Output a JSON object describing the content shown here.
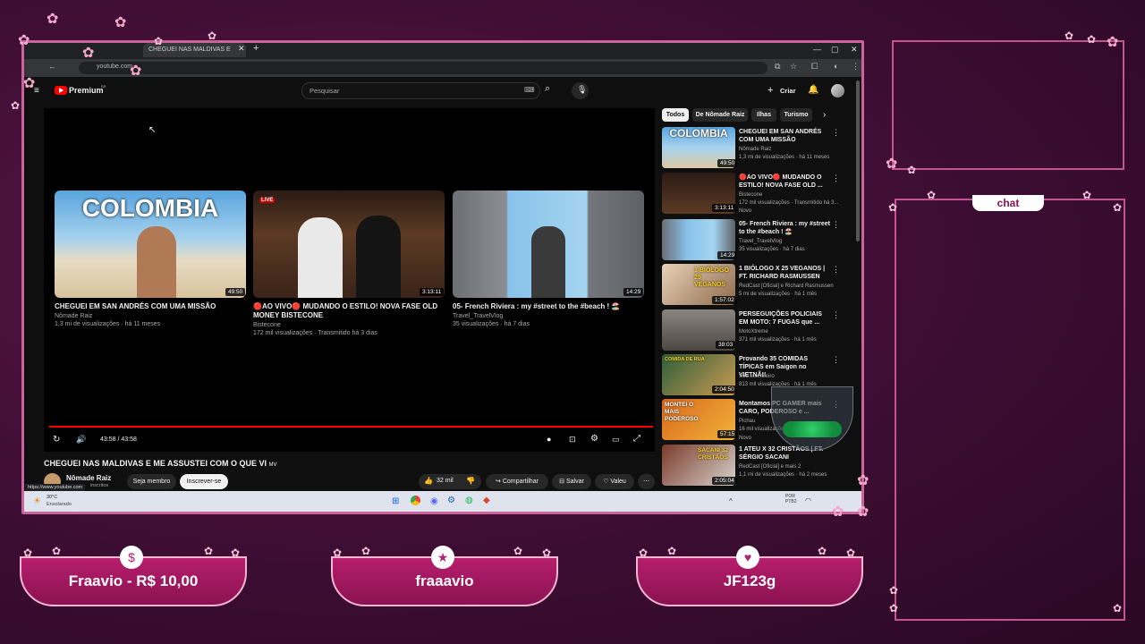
{
  "browser": {
    "tab_label": "CHEGUEI NAS MALDIVAS E ME...",
    "url": "youtube.com",
    "status_url": "https://www.youtube.com"
  },
  "youtube": {
    "logo_text": "Premium",
    "logo_badge": "BR",
    "search_placeholder": "Pesquisar",
    "create_label": "Criar",
    "video_time": "43:58 / 43:58",
    "end_cards": [
      {
        "title": "CHEGUEI EM SAN ANDRÉS COM UMA MISSÃO",
        "channel": "Nômade Raiz",
        "meta": "1,3 mi de visualizações · há 11 meses",
        "duration": "49:50",
        "thumb_text": "COLOMBIA"
      },
      {
        "title": "🔴AO VIVO🔴 MUDANDO O ESTILO! NOVA FASE OLD MONEY BISTECONE",
        "channel": "Bistecone",
        "meta": "172 mil visualizações · Transmitido há 3 dias",
        "duration": "3:13:11",
        "badge": "LIVE"
      },
      {
        "title": "05- French Riviera : my #street to the #beach ! 🏖️",
        "channel": "Travel_TravelVlog",
        "meta": "35 visualizações · há 7 dias",
        "duration": "14:29"
      }
    ],
    "video_title": "CHEGUEI NAS MALDIVAS E ME ASSUSTEI COM O QUE VI",
    "video_title_suffix": "MV",
    "channel_name": "Nômade Raiz",
    "subscribers": "inscritos",
    "member_button": "Seja membro",
    "subscribe_button": "Inscrever-se",
    "likes": "32 mil",
    "share": "Compartilhar",
    "save": "Salvar",
    "thanks": "Valeu",
    "chips": [
      "Todos",
      "De Nômade Raiz",
      "Ilhas",
      "Turismo"
    ],
    "related": [
      {
        "title": "CHEGUEI EM SAN ANDRÉS COM UMA MISSÃO",
        "channel": "Nômade Raiz",
        "meta": "1,3 mi de visualizações · há 11 meses",
        "duration": "49:50",
        "thumb_text": "COLOMBIA"
      },
      {
        "title": "🔴AO VIVO🔴 MUDANDO O ESTILO! NOVA FASE OLD ...",
        "channel": "Bistecone",
        "meta": "172 mil visualizações · Transmitido há 3...",
        "extra": "Novo",
        "duration": "3:13:11"
      },
      {
        "title": "05- French Riviera : my #street to the #beach ! 🏖️",
        "channel": "Travel_TravelVlog",
        "meta": "35 visualizações · há 7 dias",
        "duration": "14:29"
      },
      {
        "title": "1 BIÓLOGO X 25 VEGANOS | FT. RICHARD RASMUSSEN",
        "channel": "RedCast [Oficial] e Richard Rasmussen",
        "meta": "5 mi de visualizações · há 1 mês",
        "duration": "1:57:02",
        "thumb_text": "1 BIÓLOGO 25 VEGANOS"
      },
      {
        "title": "PERSEGUIÇÕES POLICIAIS EM MOTO: 7 FUGAS que ...",
        "channel": "MotoXtreme",
        "meta": "371 mil visualizações · há 1 mês",
        "duration": "38:03"
      },
      {
        "title": "Provando 35 COMIDAS TÍPICAS em Saigon no VIETNÃ!!",
        "channel": "Sou Mochileiro",
        "meta": "813 mil visualizações · há 1 mês",
        "duration": "2:04:50",
        "thumb_text": "COMIDA DE RUA"
      },
      {
        "title": "Montamos PC GAMER mais CARO, PODEROSO e ...",
        "channel": "Pichau",
        "meta": "16 mil visualizações",
        "extra": "Novo",
        "duration": "57:15",
        "thumb_text": "MONTEI O MAIS PODEROSO"
      },
      {
        "title": "1 ATEU X 32 CRISTÃOS | FT. SÉRGIO SACANI",
        "channel": "RedCast [Oficial] e mais 2",
        "meta": "1,1 mi de visualizações · há 2 meses",
        "duration": "2:05:04",
        "thumb_text": "SACANI 32 CRISTÃOS"
      }
    ]
  },
  "taskbar": {
    "weather_temp": "30°C",
    "weather_text": "Ensolarado",
    "lang": "POR PTB2"
  },
  "overlay": {
    "chat_label": "chat",
    "pills": [
      {
        "label": "Fraavio - R$ 10,00",
        "icon": "dollar-icon"
      },
      {
        "label": "fraaavio",
        "icon": "star-icon"
      },
      {
        "label": "JF123g",
        "icon": "heart-icon"
      }
    ]
  },
  "colors": {
    "background": "#3d0d33",
    "frame_border": "#c9659b",
    "pill_fill": "#b61e6c",
    "youtube_red": "#ff0000"
  }
}
